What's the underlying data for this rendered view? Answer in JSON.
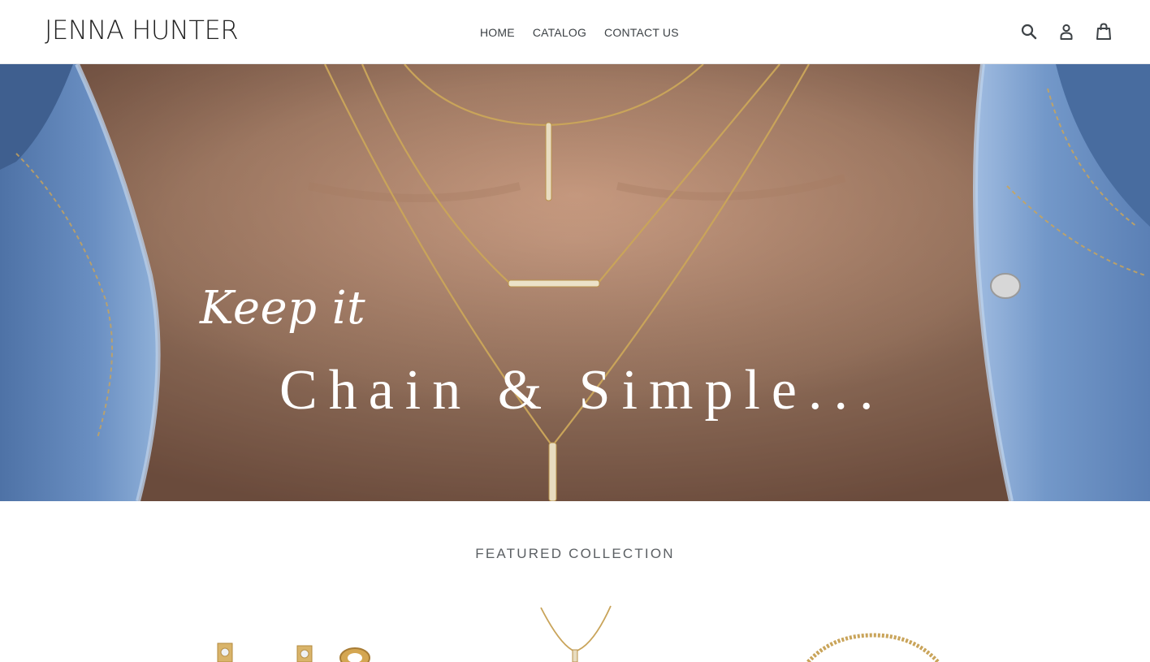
{
  "header": {
    "logo": "JENNA HUNTER",
    "nav": [
      {
        "label": "HOME"
      },
      {
        "label": "CATALOG"
      },
      {
        "label": "CONTACT US"
      }
    ],
    "icons": [
      "search-icon",
      "account-icon",
      "cart-icon"
    ]
  },
  "hero": {
    "line1": "Keep it",
    "line2": "Chain & Simple..."
  },
  "featured": {
    "title": "FEATURED COLLECTION",
    "products": [
      {
        "kind": "earrings"
      },
      {
        "kind": "necklace"
      },
      {
        "kind": "bracelet"
      }
    ]
  },
  "colors": {
    "text": "#3d4246",
    "logo": "#222222",
    "gold": "#c9a45a",
    "denim": "#5a7fb0",
    "skin": "#b48a73"
  }
}
